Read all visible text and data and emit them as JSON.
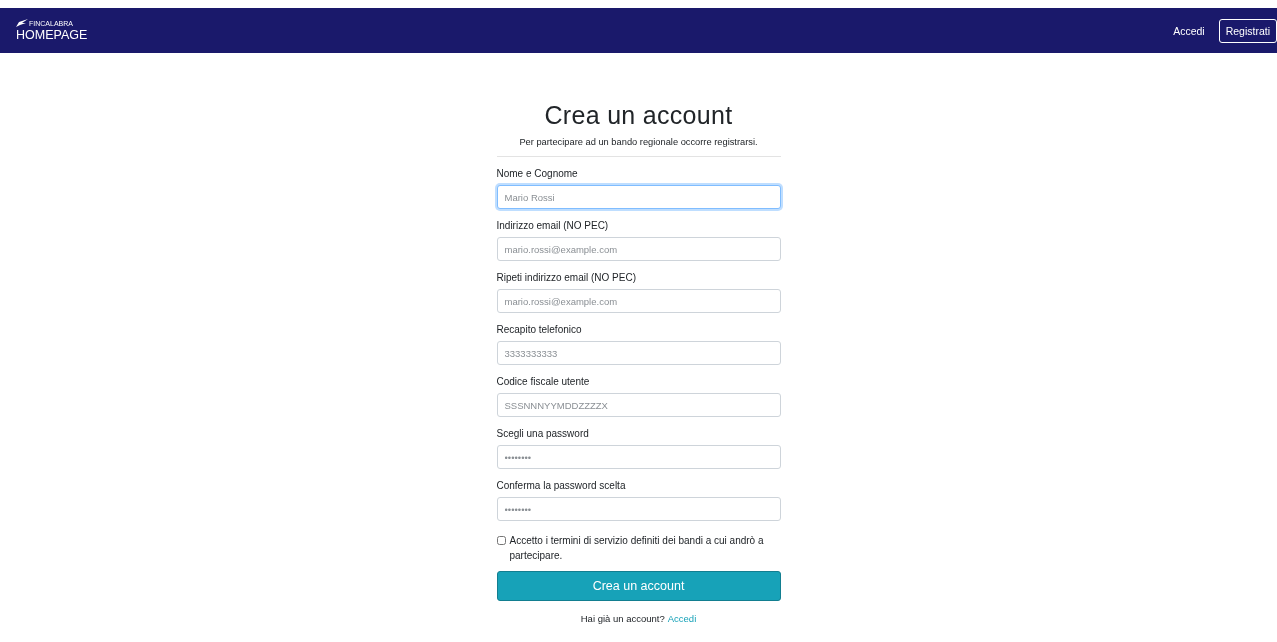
{
  "navbar": {
    "logo_text": "FINCALABRA",
    "brand": "HOMEPAGE",
    "links": [
      {
        "label": "Accedi",
        "kind": "link"
      },
      {
        "label": "Registrati",
        "kind": "outline"
      }
    ]
  },
  "form": {
    "title": "Crea un account",
    "subtitle": "Per partecipare ad un bando regionale occorre registrarsi.",
    "fields": [
      {
        "label": "Nome e Cognome",
        "placeholder": "Mario Rossi",
        "focused": true
      },
      {
        "label": "Indirizzo email (NO PEC)",
        "placeholder": "mario.rossi@example.com",
        "focused": false
      },
      {
        "label": "Ripeti indirizzo email (NO PEC)",
        "placeholder": "mario.rossi@example.com",
        "focused": false
      },
      {
        "label": "Recapito telefonico",
        "placeholder": "3333333333",
        "focused": false
      },
      {
        "label": "Codice fiscale utente",
        "placeholder": "SSSNNNYYMDDZZZZX",
        "focused": false
      },
      {
        "label": "Scegli una password",
        "placeholder": "••••••••",
        "focused": false
      },
      {
        "label": "Conferma la password scelta",
        "placeholder": "••••••••",
        "focused": false
      }
    ],
    "terms": {
      "label": "Accetto i termini di servizio definiti dei bandi a cui andrò a partecipare.",
      "checked": false
    },
    "submit": "Crea un account",
    "footer": {
      "text": "Hai già un account?",
      "link": "Accedi"
    }
  }
}
